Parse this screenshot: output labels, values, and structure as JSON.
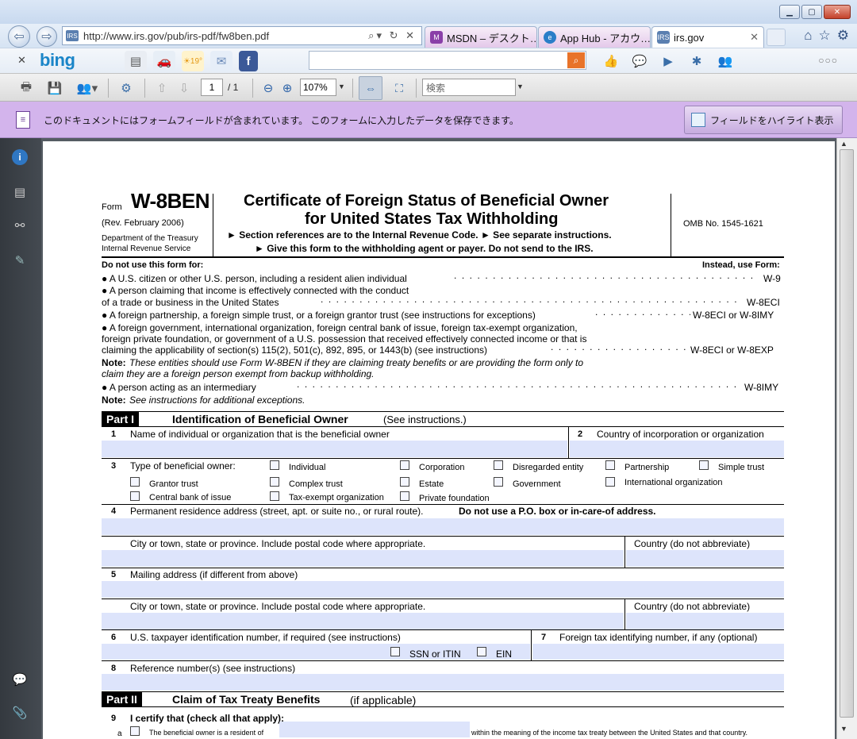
{
  "browser": {
    "url": "http://www.irs.gov/pub/irs-pdf/fw8ben.pdf",
    "tabs": [
      {
        "label": "MSDN – デスクト…"
      },
      {
        "label": "App Hub - アカウ…"
      },
      {
        "label": "irs.gov"
      }
    ],
    "bing_logo": "bing",
    "weather_temp": "19°"
  },
  "pdf_toolbar": {
    "page_current": "1",
    "page_total": "/ 1",
    "zoom": "107%",
    "search_placeholder": "検索"
  },
  "form_bar": {
    "message": "このドキュメントにはフォームフィールドが含まれています。 このフォームに入力したデータを保存できます。",
    "highlight_button": "フィールドをハイライト表示"
  },
  "form": {
    "form_word": "Form",
    "form_number": "W-8BEN",
    "rev": "(Rev. February 2006)",
    "dept1": "Department of the Treasury",
    "dept2": "Internal Revenue Service",
    "title1": "Certificate of Foreign Status of Beneficial Owner",
    "title2": "for United States Tax Withholding",
    "sub1": "► Section references are to the Internal Revenue Code.   ► See separate instructions.",
    "sub2": "► Give this form to the withholding agent or payer. Do not send to the IRS.",
    "omb": "OMB No. 1545-1621",
    "do_not_use": "Do not use this form for:",
    "instead": "Instead, use Form:",
    "rows": [
      {
        "text": "● A U.S. citizen or other U.S. person, including a resident alien individual",
        "form": "W-9"
      },
      {
        "text": "● A person claiming that income is effectively connected with the conduct",
        "form": ""
      },
      {
        "text": "   of a trade or business in the United States",
        "form": "W-8ECI"
      },
      {
        "text": "● A foreign partnership, a foreign simple trust, or a foreign grantor trust (see instructions for exceptions)",
        "form": "W-8ECI or W-8IMY"
      },
      {
        "text": "● A foreign government, international organization, foreign central bank of issue, foreign tax-exempt organization,",
        "form": ""
      },
      {
        "text": "   foreign private foundation, or government of a U.S. possession that received effectively connected income or that is",
        "form": ""
      },
      {
        "text": "   claiming the applicability of section(s) 115(2), 501(c), 892, 895, or 1443(b) (see instructions)",
        "form": "W-8ECI or W-8EXP"
      }
    ],
    "note1_label": "Note:",
    "note1_a": "These entities should use Form W-8BEN if they are claiming treaty benefits or are providing the form only to",
    "note1_b": "claim they are a foreign person exempt from backup withholding.",
    "intermediary": "● A person acting as an intermediary",
    "intermediary_form": "W-8IMY",
    "note2_label": "Note:",
    "note2": "See instructions for additional exceptions.",
    "part1_label": "Part I",
    "part1_title": "Identification of Beneficial Owner",
    "part1_sub": "(See instructions.)",
    "l1_num": "1",
    "l1": "Name of individual or organization that is the beneficial owner",
    "l2_num": "2",
    "l2": "Country of incorporation or organization",
    "l3_num": "3",
    "l3": "Type of beneficial owner:",
    "owner_types": [
      "Individual",
      "Corporation",
      "Disregarded entity",
      "Partnership",
      "Simple trust",
      "Grantor trust",
      "Complex trust",
      "Estate",
      "Government",
      "International organization",
      "Central bank of issue",
      "Tax-exempt organization",
      "Private foundation"
    ],
    "l4_num": "4",
    "l4": "Permanent residence address (street, apt. or suite no., or rural route).",
    "l4_bold": "Do not use a P.O. box or in-care-of address.",
    "city": "City or town, state or province. Include postal code where appropriate.",
    "country": "Country (do not abbreviate)",
    "l5_num": "5",
    "l5": "Mailing address (if different from above)",
    "l6_num": "6",
    "l6": "U.S. taxpayer identification number, if required (see instructions)",
    "ssn": "SSN or ITIN",
    "ein": "EIN",
    "l7_num": "7",
    "l7": "Foreign tax identifying number, if any (optional)",
    "l8_num": "8",
    "l8": "Reference number(s) (see instructions)",
    "part2_label": "Part II",
    "part2_title": "Claim of Tax Treaty Benefits",
    "part2_sub": "(if applicable)",
    "l9_num": "9",
    "l9": "I certify that (check all that apply):",
    "l9a_prefix": "a",
    "l9a_text_a": "The beneficial owner is a resident of",
    "l9a_text_b": "within the meaning of the income tax treaty between the United States and that country."
  },
  "colors": {
    "form_bar": "#d3b4ec",
    "field_fill": "#dde4fb"
  }
}
